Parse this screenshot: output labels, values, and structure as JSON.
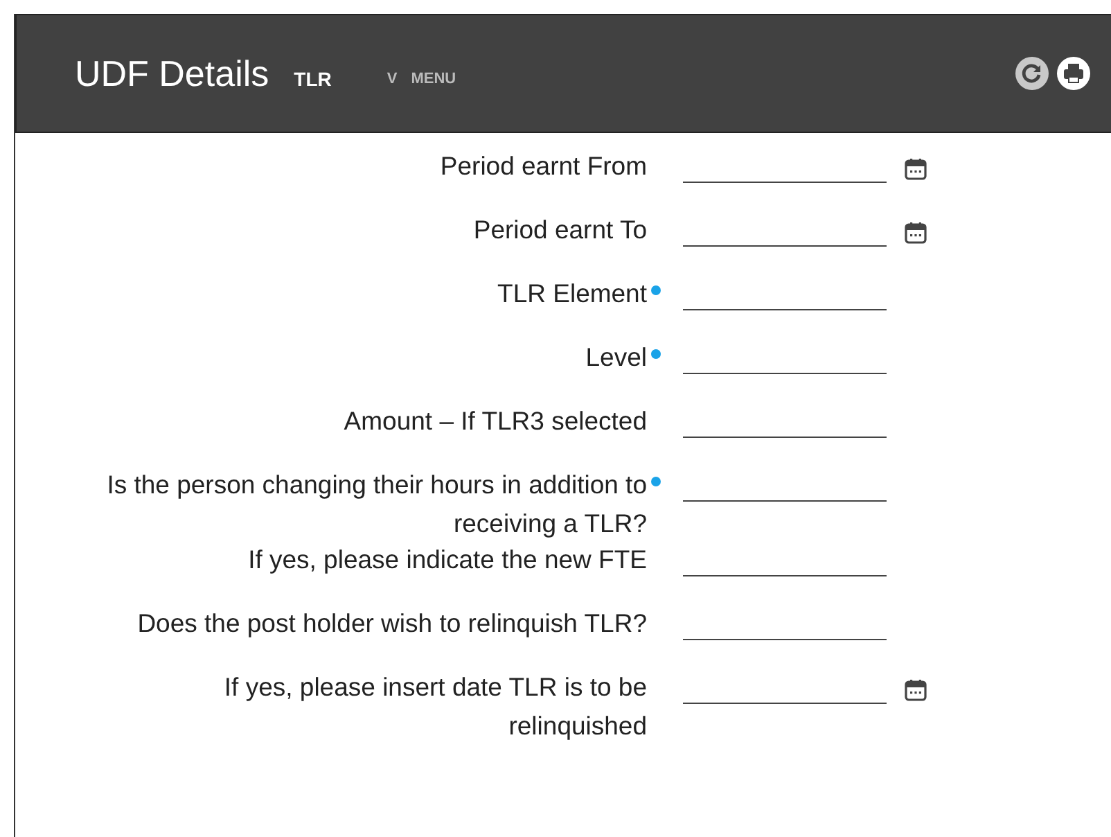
{
  "header": {
    "title": "UDF Details",
    "subtitle": "TLR",
    "menu_caret": "V",
    "menu": "MENU"
  },
  "fields": [
    {
      "label": "Period earnt From",
      "required": false,
      "date_picker": true
    },
    {
      "label": "Period earnt To",
      "required": false,
      "date_picker": true
    },
    {
      "label": "TLR Element",
      "required": true,
      "date_picker": false
    },
    {
      "label": "Level",
      "required": true,
      "date_picker": false
    },
    {
      "label": "Amount – If TLR3 selected",
      "required": false,
      "date_picker": false
    },
    {
      "label": "Is the person changing their hours in addition to receiving a TLR?",
      "required": true,
      "date_picker": false
    },
    {
      "label": "If yes, please indicate the new FTE",
      "required": false,
      "date_picker": false
    },
    {
      "label": "Does the post holder wish to relinquish TLR?",
      "required": false,
      "date_picker": false
    },
    {
      "label": "If yes, please insert date TLR is to be relinquished",
      "required": false,
      "date_picker": true
    }
  ]
}
